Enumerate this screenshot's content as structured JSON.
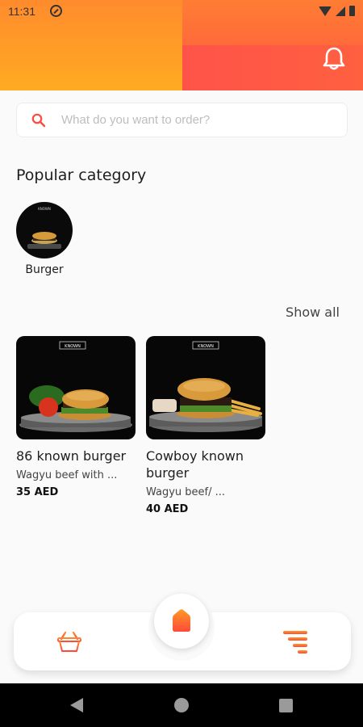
{
  "status_bar": {
    "time": "11:31"
  },
  "search": {
    "placeholder": "What do you want to order?"
  },
  "popular": {
    "title": "Popular category",
    "categories": [
      {
        "label": "Burger",
        "icon": "burger-image"
      }
    ]
  },
  "products": {
    "show_all_label": "Show all",
    "items": [
      {
        "name": "86 known burger",
        "description": "Wagyu beef with ...",
        "price": "35 AED"
      },
      {
        "name": "Cowboy known burger",
        "description": "Wagyu beef/  ...",
        "price": "40 AED"
      }
    ]
  },
  "bottom_nav": {
    "items": [
      {
        "icon": "basket-icon"
      },
      {
        "icon": "home-icon",
        "active": true
      },
      {
        "icon": "filter-menu-icon"
      }
    ]
  },
  "colors": {
    "accent": "#ff5a36",
    "header_orange": "#ffab21",
    "header_red": "#ff5349"
  }
}
